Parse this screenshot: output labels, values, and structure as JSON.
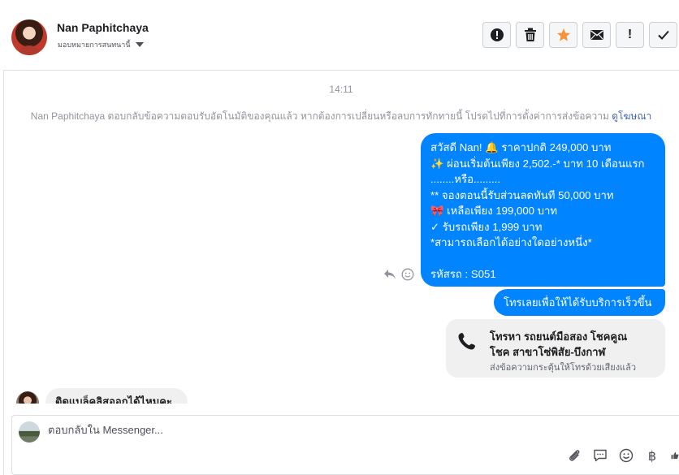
{
  "header": {
    "contact_name": "Nan Paphitchaya",
    "assign_label": "มอบหมายการสนทนานี้",
    "tools": {
      "spam": "!",
      "mark_unread": "!"
    }
  },
  "thread": {
    "time": "14:11",
    "system_message": "Nan Paphitchaya ตอบกลับข้อความตอบรับอัตโนมัติของคุณแล้ว หากต้องการเปลี่ยนหรือลบการทักทายนี้ โปรดไปที่การตั้งค่าการส่งข้อความ",
    "system_link": "ดูโฆษณา",
    "outgoing_main": [
      "สวัสดี Nan! 🔔  ราคาปกติ 249,000 บาท",
      "✨  ผ่อนเริ่มต้นเพียง 2,502.-* บาท 10 เดือนแรก",
      "........หรือ.........",
      "** จองตอนนี้รับส่วนลดทันที 50,000 บาท",
      "🎀  เหลือเพียง 199,000 บาท",
      "✓ รับรถเพียง 1,999 บาท",
      "*สามารถเลือกได้อย่างใดอย่างหนึ่ง*",
      "",
      "รหัสรถ : S051"
    ],
    "outgoing_call": "โทรเลยเพื่อให้ได้รับบริการเร็วขึ้น",
    "call_card": {
      "title_line1": "โทรหา รถยนต์มือสอง โชคคูณ",
      "title_line2": "โชค สาขาโซ่พิสัย-บึงกาฬ",
      "subtitle": "ส่งข้อความกระตุ้นให้โทรด้วยเสียงแล้ว"
    },
    "incoming": "ติดแบล็คลิสออกได้ไหมคะ"
  },
  "composer": {
    "placeholder": "ตอบกลับใน Messenger..."
  },
  "colors": {
    "brand_blue": "#0084ff",
    "star_orange": "#f7923b",
    "link_blue": "#4267b2"
  },
  "icons": [
    "alert-icon",
    "trash-icon",
    "star-icon",
    "envelope-icon",
    "exclamation-icon",
    "check-icon",
    "reply-icon",
    "emoji-icon",
    "phone-icon",
    "paperclip-icon",
    "saved-reply-icon",
    "emoji-icon",
    "baht-icon",
    "like-icon"
  ]
}
